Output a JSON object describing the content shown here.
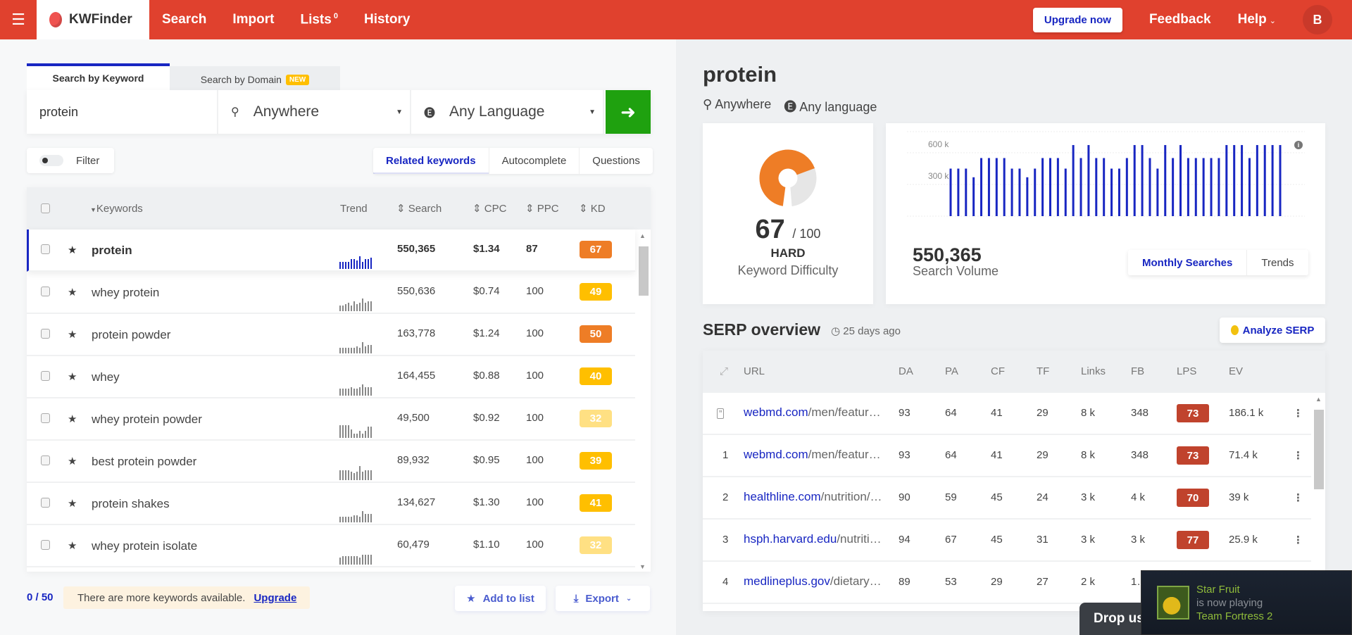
{
  "header": {
    "menu_icon": "hamburger-icon",
    "brand": "KWFinder",
    "nav": [
      {
        "label": "Search"
      },
      {
        "label": "Import"
      },
      {
        "label": "Lists",
        "badge": "0"
      },
      {
        "label": "History"
      }
    ],
    "upgrade_label": "Upgrade now",
    "feedback_label": "Feedback",
    "help_label": "Help",
    "avatar_initial": "B"
  },
  "search": {
    "tabs": [
      {
        "label": "Search by Keyword",
        "active": true
      },
      {
        "label": "Search by Domain",
        "badge": "NEW",
        "active": false
      }
    ],
    "keyword_value": "protein",
    "location": "Anywhere",
    "language": "Any Language",
    "go_icon": "arrow-right-icon"
  },
  "filter": {
    "label": "Filter",
    "enabled": false
  },
  "subtabs": [
    {
      "label": "Related keywords",
      "active": true
    },
    {
      "label": "Autocomplete",
      "active": false
    },
    {
      "label": "Questions",
      "active": false
    }
  ],
  "keyword_table": {
    "columns": {
      "keywords": "Keywords",
      "trend": "Trend",
      "search": "Search",
      "cpc": "CPC",
      "ppc": "PPC",
      "kd": "KD"
    },
    "rows": [
      {
        "keyword": "protein",
        "search": "550,365",
        "cpc": "$1.34",
        "ppc": "87",
        "kd": "67",
        "kd_color": "#ee7d26",
        "selected": true,
        "trend": [
          5,
          5,
          5,
          5,
          7,
          7,
          6,
          9,
          5,
          7,
          7,
          8
        ]
      },
      {
        "keyword": "whey protein",
        "search": "550,636",
        "cpc": "$0.74",
        "ppc": "100",
        "kd": "49",
        "kd_color": "#ffbf00",
        "selected": false,
        "trend": [
          4,
          4,
          5,
          6,
          4,
          7,
          5,
          6,
          9,
          6,
          7,
          7
        ]
      },
      {
        "keyword": "protein powder",
        "search": "163,778",
        "cpc": "$1.24",
        "ppc": "100",
        "kd": "50",
        "kd_color": "#ee7d26",
        "selected": false,
        "trend": [
          4,
          4,
          4,
          4,
          4,
          4,
          5,
          4,
          8,
          5,
          6,
          6
        ]
      },
      {
        "keyword": "whey",
        "search": "164,455",
        "cpc": "$0.88",
        "ppc": "100",
        "kd": "40",
        "kd_color": "#ffbf00",
        "selected": false,
        "trend": [
          5,
          5,
          5,
          5,
          6,
          5,
          5,
          6,
          8,
          6,
          6,
          6
        ]
      },
      {
        "keyword": "whey protein powder",
        "search": "49,500",
        "cpc": "$0.92",
        "ppc": "100",
        "kd": "32",
        "kd_color": "#ffe083",
        "selected": false,
        "trend": [
          9,
          9,
          9,
          9,
          6,
          3,
          3,
          5,
          3,
          5,
          8,
          8
        ]
      },
      {
        "keyword": "best protein powder",
        "search": "89,932",
        "cpc": "$0.95",
        "ppc": "100",
        "kd": "39",
        "kd_color": "#ffbf00",
        "selected": false,
        "trend": [
          7,
          7,
          7,
          7,
          6,
          5,
          6,
          10,
          6,
          7,
          7,
          7
        ]
      },
      {
        "keyword": "protein shakes",
        "search": "134,627",
        "cpc": "$1.30",
        "ppc": "100",
        "kd": "41",
        "kd_color": "#ffbf00",
        "selected": false,
        "trend": [
          4,
          4,
          4,
          4,
          4,
          5,
          5,
          4,
          8,
          6,
          6,
          6
        ]
      },
      {
        "keyword": "whey protein isolate",
        "search": "60,479",
        "cpc": "$1.10",
        "ppc": "100",
        "kd": "32",
        "kd_color": "#ffe083",
        "selected": false,
        "trend": [
          5,
          6,
          6,
          6,
          6,
          6,
          6,
          5,
          7,
          7,
          7,
          7
        ]
      }
    ]
  },
  "footer": {
    "count": "0 / 50",
    "more_text": "There are more keywords available.",
    "upgrade_link": "Upgrade",
    "add_to_list": "Add to list",
    "export": "Export"
  },
  "detail": {
    "keyword": "protein",
    "location": "Anywhere",
    "language": "Any language",
    "kd_value": 67,
    "kd_max": "/ 100",
    "kd_level": "HARD",
    "kd_label": "Keyword Difficulty",
    "kd_color": "#ee7d26",
    "search_volume": "550,365",
    "search_volume_label": "Search Volume",
    "volume_tabs": [
      {
        "label": "Monthly Searches",
        "active": true
      },
      {
        "label": "Trends",
        "active": false
      }
    ]
  },
  "chart_data": {
    "type": "bar",
    "title": "",
    "xlabel": "",
    "ylabel": "",
    "ylim": [
      0,
      800000
    ],
    "yticks": [
      {
        "value": 300000,
        "label": "300 k"
      },
      {
        "value": 600000,
        "label": "600 k"
      }
    ],
    "grid": true,
    "color": "#1826c2",
    "values": [
      450000,
      450000,
      450000,
      368000,
      550000,
      550000,
      550000,
      550000,
      450000,
      450000,
      368000,
      450000,
      550000,
      550000,
      550000,
      450000,
      673000,
      550000,
      673000,
      550000,
      550000,
      450000,
      450000,
      550000,
      673000,
      673000,
      550000,
      450000,
      673000,
      550000,
      673000,
      550000,
      550000,
      550000,
      550000,
      550000,
      673000,
      673000,
      673000,
      550000,
      673000,
      673000,
      673000,
      673000
    ]
  },
  "serp": {
    "title": "SERP overview",
    "age": "25 days ago",
    "analyze_label": "Analyze SERP",
    "columns": [
      "URL",
      "DA",
      "PA",
      "CF",
      "TF",
      "Links",
      "FB",
      "LPS",
      "EV"
    ],
    "rows": [
      {
        "pos": "",
        "pos_icon": "featured-snippet-icon",
        "domain": "webmd.com",
        "path": "/men/featur…",
        "da": "93",
        "pa": "64",
        "cf": "41",
        "tf": "29",
        "links": "8 k",
        "fb": "348",
        "lps": "73",
        "ev": "186.1 k"
      },
      {
        "pos": "1",
        "domain": "webmd.com",
        "path": "/men/featur…",
        "da": "93",
        "pa": "64",
        "cf": "41",
        "tf": "29",
        "links": "8 k",
        "fb": "348",
        "lps": "73",
        "ev": "71.4 k"
      },
      {
        "pos": "2",
        "domain": "healthline.com",
        "path": "/nutrition/…",
        "da": "90",
        "pa": "59",
        "cf": "45",
        "tf": "24",
        "links": "3 k",
        "fb": "4 k",
        "lps": "70",
        "ev": "39 k"
      },
      {
        "pos": "3",
        "domain": "hsph.harvard.edu",
        "path": "/nutriti…",
        "da": "94",
        "pa": "67",
        "cf": "45",
        "tf": "31",
        "links": "3 k",
        "fb": "3 k",
        "lps": "77",
        "ev": "25.9 k"
      },
      {
        "pos": "4",
        "domain": "medlineplus.gov",
        "path": "/dietary…",
        "da": "89",
        "pa": "53",
        "cf": "29",
        "tf": "27",
        "links": "2 k",
        "fb": "1…",
        "lps": "",
        "ev": ""
      }
    ]
  },
  "overlays": {
    "chat_label": "Drop us",
    "steam": {
      "name": "Star Fruit",
      "status": "is now playing",
      "game": "Team Fortress 2"
    }
  }
}
